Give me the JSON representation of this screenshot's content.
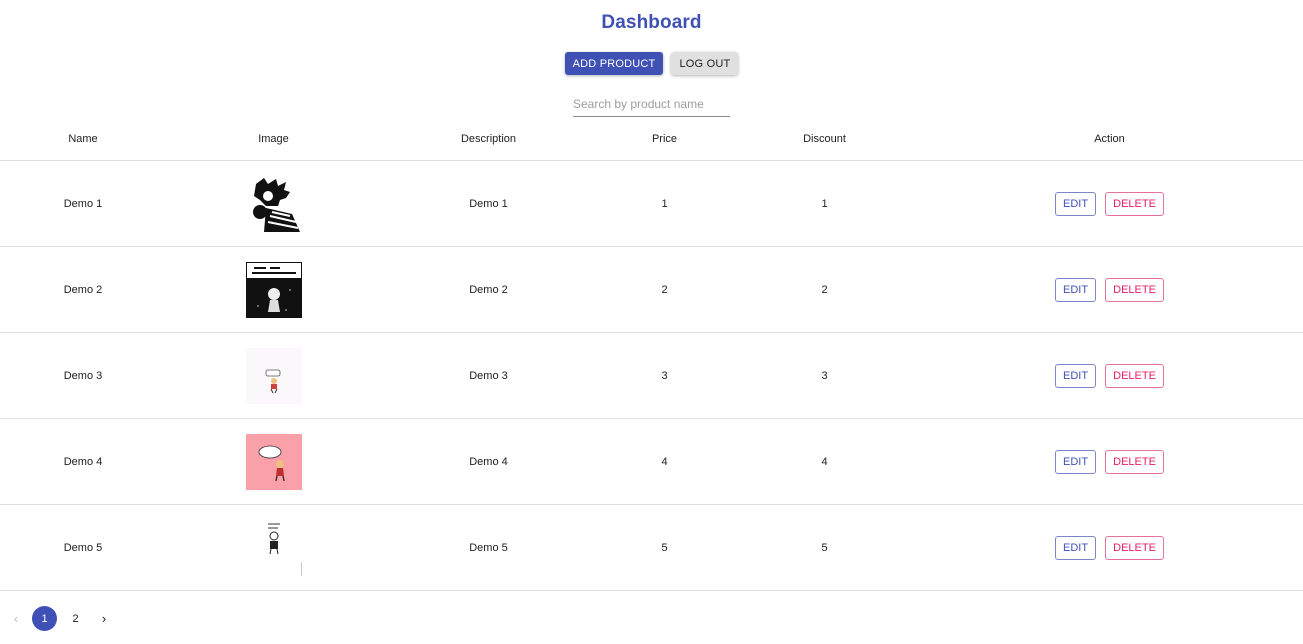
{
  "header": {
    "title": "Dashboard",
    "add_product_label": "ADD PRODUCT",
    "logout_label": "LOG OUT"
  },
  "search": {
    "placeholder": "Search by product name",
    "value": ""
  },
  "table": {
    "columns": [
      "Name",
      "Image",
      "Description",
      "Price",
      "Discount",
      "Action"
    ],
    "rows": [
      {
        "name": "Demo 1",
        "image": "comic-thumbnail-1",
        "description": "Demo 1",
        "price": "1",
        "discount": "1",
        "edit_label": "EDIT",
        "delete_label": "DELETE"
      },
      {
        "name": "Demo 2",
        "image": "comic-thumbnail-2",
        "description": "Demo 2",
        "price": "2",
        "discount": "2",
        "edit_label": "EDIT",
        "delete_label": "DELETE"
      },
      {
        "name": "Demo 3",
        "image": "comic-thumbnail-3",
        "description": "Demo 3",
        "price": "3",
        "discount": "3",
        "edit_label": "EDIT",
        "delete_label": "DELETE"
      },
      {
        "name": "Demo 4",
        "image": "comic-thumbnail-4",
        "description": "Demo 4",
        "price": "4",
        "discount": "4",
        "edit_label": "EDIT",
        "delete_label": "DELETE"
      },
      {
        "name": "Demo 5",
        "image": "comic-thumbnail-5",
        "description": "Demo 5",
        "price": "5",
        "discount": "5",
        "edit_label": "EDIT",
        "delete_label": "DELETE"
      }
    ]
  },
  "pagination": {
    "pages": [
      "1",
      "2"
    ],
    "current_page": "1",
    "prev_icon": "chevron-left-icon",
    "next_icon": "chevron-right-icon"
  },
  "colors": {
    "primary": "#3f51b5",
    "secondary": "#e91e63"
  }
}
